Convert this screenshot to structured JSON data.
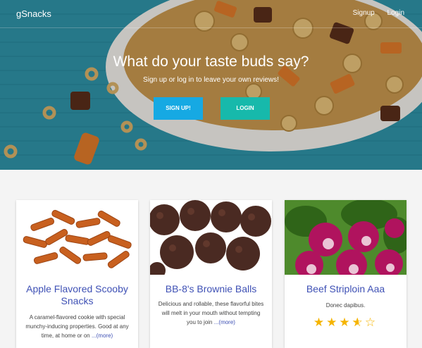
{
  "nav": {
    "brand": "gSnacks",
    "signup": "Signup",
    "login": "Login"
  },
  "hero": {
    "title": "What do your taste buds say?",
    "subtitle": "Sign up or log in to leave your own reviews!",
    "signup_button": "SIGN UP!",
    "login_button": "LOGIN"
  },
  "cards": [
    {
      "title": "Apple Flavored Scooby Snacks",
      "description": "A caramel-flavored cookie with special munchy-inducing properties. Good at any time, at home or on",
      "more": "...(more)"
    },
    {
      "title": "BB-8's Brownie Balls",
      "description": "Delicious and rollable, these flavorful bites will melt in your mouth without tempting you to join",
      "more": "...(more)"
    },
    {
      "title": "Beef Striploin Aaa",
      "description": "Donec dapibus.",
      "rating": 3.5,
      "rating_max": 5
    }
  ],
  "colors": {
    "signup": "#16a9e3",
    "login": "#17b9ab",
    "title": "#3f51b5",
    "star": "#f5b400"
  }
}
